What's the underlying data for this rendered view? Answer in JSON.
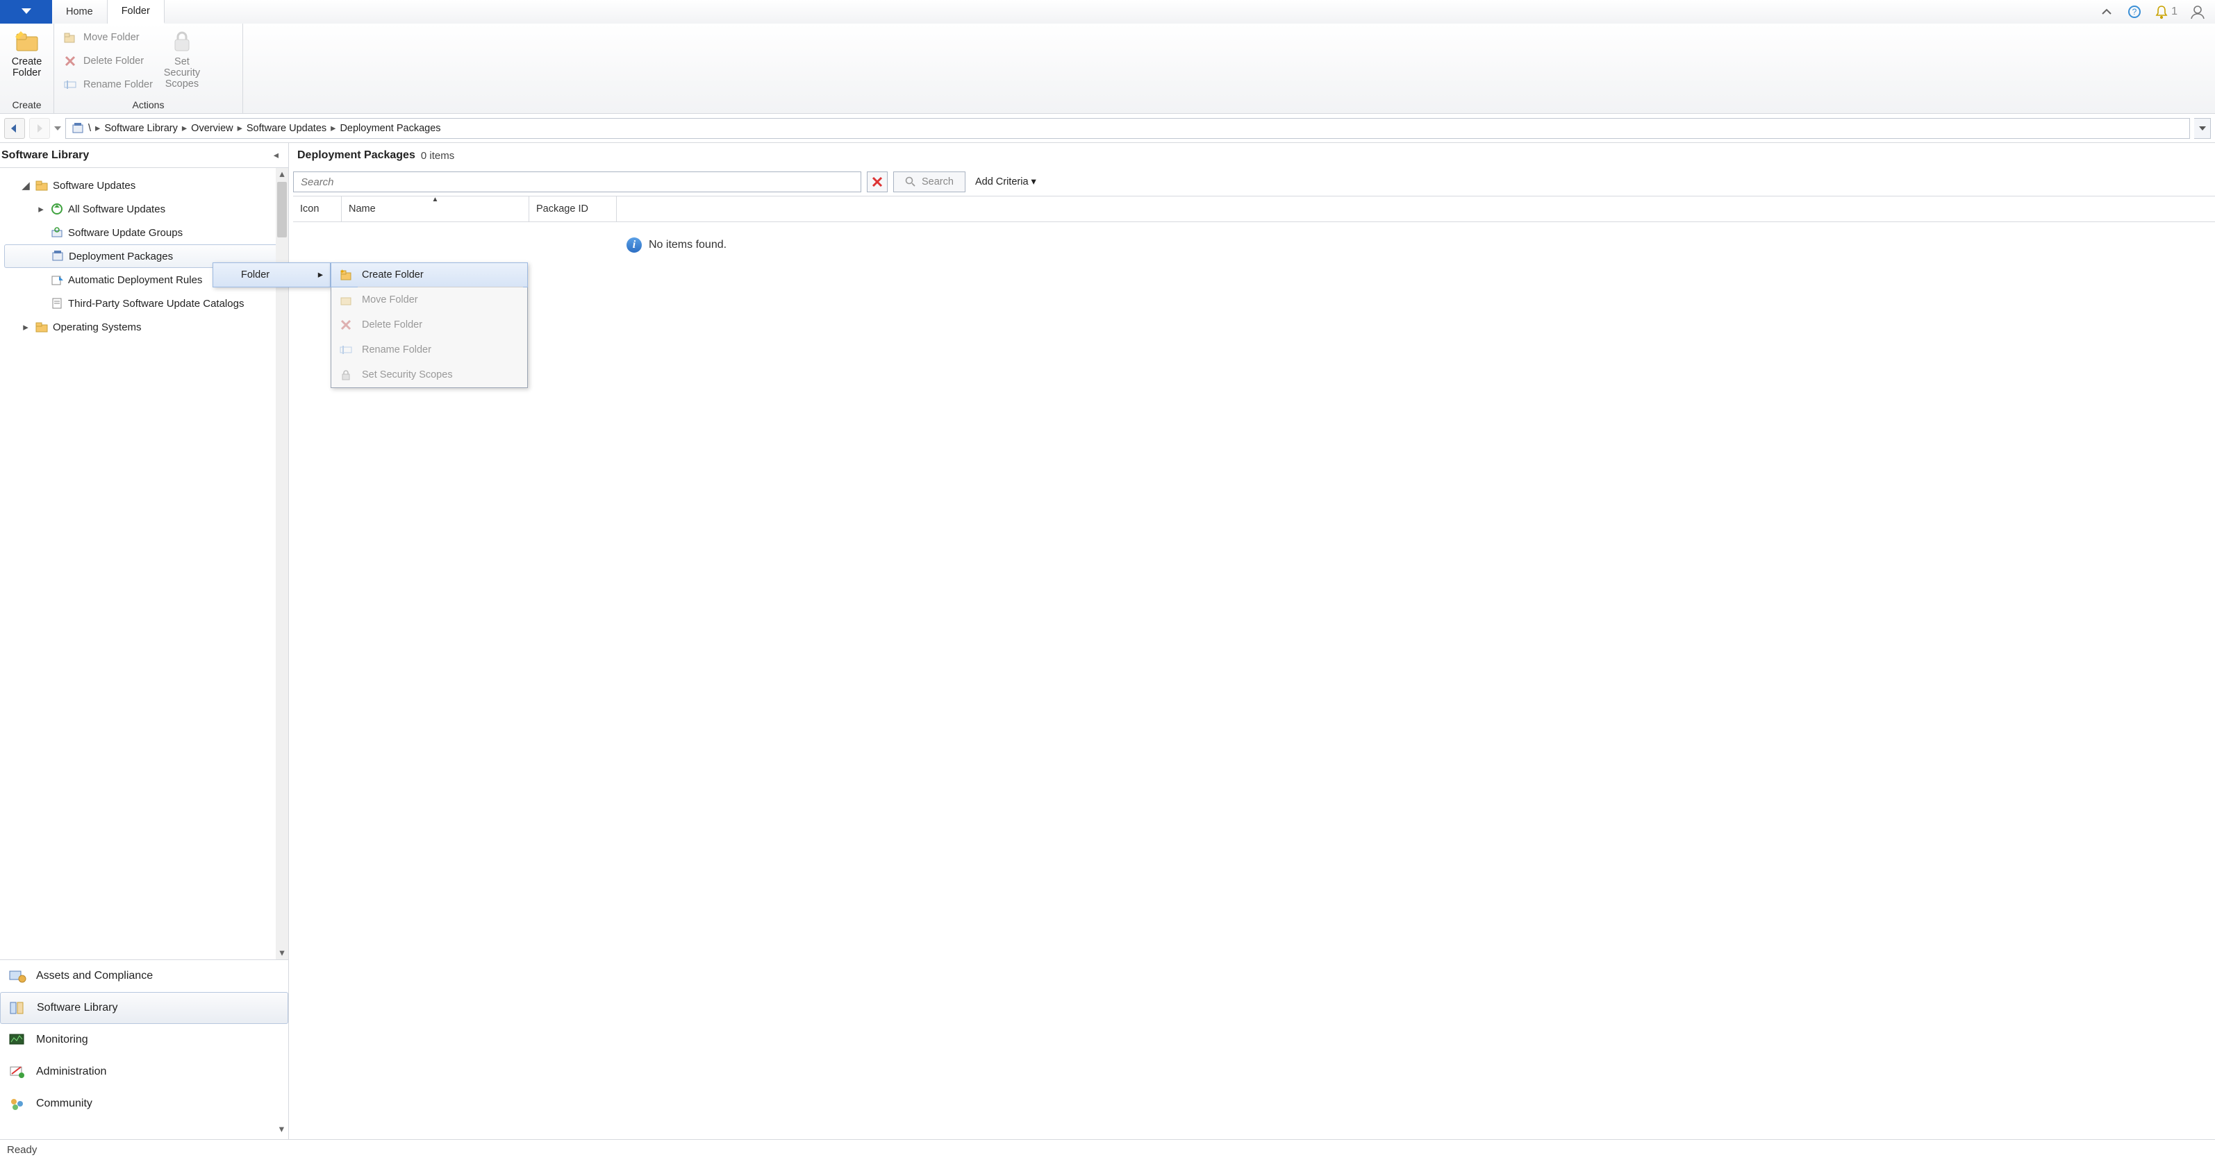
{
  "tabs": {
    "home": "Home",
    "folder": "Folder"
  },
  "top_right": {
    "notif_count": "1"
  },
  "ribbon": {
    "create": {
      "create_folder": "Create\nFolder",
      "group": "Create"
    },
    "actions": {
      "move": "Move Folder",
      "delete": "Delete Folder",
      "rename": "Rename Folder",
      "scopes": "Set Security\nScopes",
      "group": "Actions"
    }
  },
  "breadcrumb": {
    "items": [
      "\\",
      "Software Library",
      "Overview",
      "Software Updates",
      "Deployment Packages"
    ]
  },
  "sidebar": {
    "title": "Software Library",
    "tree": {
      "root": "Software Updates",
      "items": [
        "All Software Updates",
        "Software Update Groups",
        "Deployment Packages",
        "Automatic Deployment Rules",
        "Third-Party Software Update Catalogs"
      ],
      "os": "Operating Systems"
    },
    "wunder": [
      "Assets and Compliance",
      "Software Library",
      "Monitoring",
      "Administration",
      "Community"
    ]
  },
  "content": {
    "title": "Deployment Packages",
    "count": "0 items",
    "search_placeholder": "Search",
    "search_btn": "Search",
    "add_criteria": "Add Criteria",
    "cols": {
      "icon": "Icon",
      "name": "Name",
      "pkgid": "Package ID"
    },
    "empty": "No items found."
  },
  "context1": {
    "folder": "Folder"
  },
  "context2": {
    "create": "Create Folder",
    "move": "Move Folder",
    "delete": "Delete Folder",
    "rename": "Rename Folder",
    "scopes": "Set Security Scopes"
  },
  "status": "Ready"
}
